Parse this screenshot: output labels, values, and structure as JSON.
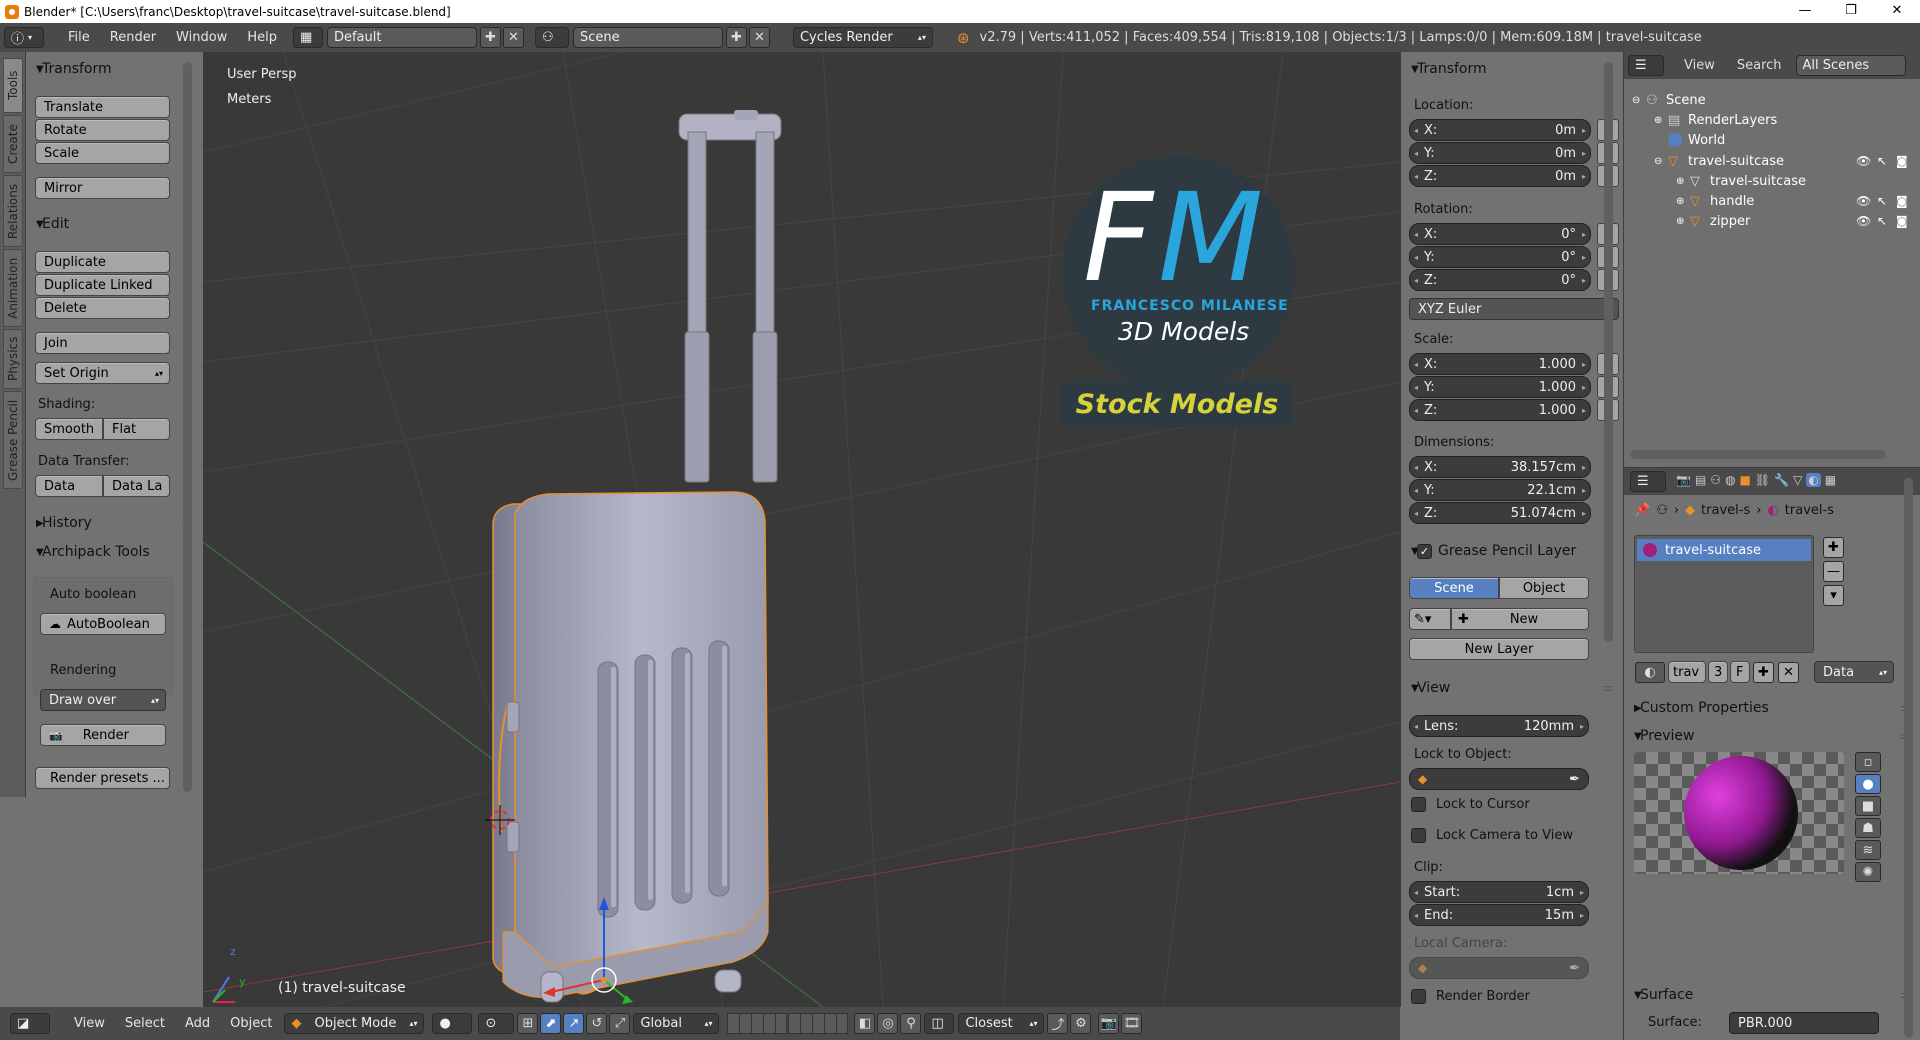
{
  "titlebar": {
    "title": "Blender* [C:\\Users\\franc\\Desktop\\travel-suitcase\\travel-suitcase.blend]",
    "minimize": "—",
    "maximize": "❐",
    "close": "✕"
  },
  "menubar": {
    "info_icon": "ⓘ",
    "items": [
      "File",
      "Render",
      "Window",
      "Help"
    ],
    "layout": "Default",
    "scene": "Scene",
    "engine": "Cycles Render",
    "stats": "v2.79 | Verts:411,052 | Faces:409,554 | Tris:819,108 | Objects:1/3 | Lamps:0/0 | Mem:609.18M | travel-suitcase"
  },
  "tooltabs": [
    "Tools",
    "Create",
    "Relations",
    "Animation",
    "Physics",
    "Grease Pencil"
  ],
  "toolshelf": {
    "transform": {
      "title": "Transform",
      "buttons": [
        "Translate",
        "Rotate",
        "Scale",
        "Mirror"
      ]
    },
    "edit": {
      "title": "Edit",
      "buttons": [
        "Duplicate",
        "Duplicate Linked",
        "Delete",
        "Join"
      ],
      "set_origin": "Set Origin",
      "shading_label": "Shading:",
      "smooth": "Smooth",
      "flat": "Flat",
      "data_transfer_label": "Data Transfer:",
      "data": "Data",
      "data_layers": "Data La"
    },
    "history": {
      "title": "History"
    },
    "archipack": {
      "title": "Archipack Tools",
      "auto_boolean_label": "Auto boolean",
      "autoboolean_btn": "AutoBoolean",
      "rendering_label": "Rendering",
      "draw_over": "Draw over",
      "render_btn": "Render",
      "render_presets": "Render presets ..."
    }
  },
  "viewport": {
    "view_label": "User Persp",
    "units_label": "Meters",
    "object_label": "(1) travel-suitcase",
    "axis_x": "x",
    "axis_y": "y",
    "axis_z": "z",
    "watermark": {
      "initials_f": "F",
      "initials_m": "M",
      "name": "FRANCESCO MILANESE",
      "subtitle": "3D Models",
      "banner": "Stock Models"
    }
  },
  "npanel": {
    "transform_title": "Transform",
    "location_label": "Location:",
    "location": {
      "x": "0m",
      "y": "0m",
      "z": "0m"
    },
    "rotation_label": "Rotation:",
    "rotation": {
      "x": "0°",
      "y": "0°",
      "z": "0°"
    },
    "rotation_mode": "XYZ Euler",
    "scale_label": "Scale:",
    "scale": {
      "x": "1.000",
      "y": "1.000",
      "z": "1.000"
    },
    "dimensions_label": "Dimensions:",
    "dimensions": {
      "x": "38.157cm",
      "y": "22.1cm",
      "z": "51.074cm"
    },
    "axis_labels": {
      "x": "X:",
      "y": "Y:",
      "z": "Z:"
    },
    "grease_title": "Grease Pencil Layer",
    "scene_tab": "Scene",
    "object_tab": "Object",
    "new_btn": "New",
    "new_layer_btn": "New Layer",
    "view_title": "View",
    "lens_label": "Lens:",
    "lens_value": "120mm",
    "lock_to_object_label": "Lock to Object:",
    "lock_to_cursor": "Lock to Cursor",
    "lock_camera": "Lock Camera to View",
    "clip_label": "Clip:",
    "clip_start_label": "Start:",
    "clip_start": "1cm",
    "clip_end_label": "End:",
    "clip_end": "15m",
    "local_camera_label": "Local Camera:",
    "render_border": "Render Border"
  },
  "outliner": {
    "view": "View",
    "search": "Search",
    "filter": "All Scenes",
    "rows": [
      {
        "label": "Scene"
      },
      {
        "label": "RenderLayers"
      },
      {
        "label": "World"
      },
      {
        "label": "travel-suitcase"
      },
      {
        "label": "travel-suitcase"
      },
      {
        "label": "handle"
      },
      {
        "label": "zipper"
      }
    ]
  },
  "props": {
    "breadcrumb_obj": "travel-s",
    "breadcrumb_mat": "travel-s",
    "material_slot": "travel-suitcase",
    "mat_name": "trav",
    "users": "3",
    "fake": "F",
    "link": "Data",
    "custom_properties": "Custom Properties",
    "preview": "Preview",
    "surface": "Surface",
    "surface_label": "Surface:",
    "surface_value": "PBR.000"
  },
  "bottombar": {
    "view": "View",
    "select": "Select",
    "add": "Add",
    "object": "Object",
    "mode": "Object Mode",
    "orientation": "Global",
    "snap": "Closest"
  },
  "colors": {
    "selection_outline": "#e8902a",
    "accent_blue": "#5680c2",
    "banner_yellow": "#d6d23a",
    "fm_blue": "#2aa6dc"
  }
}
